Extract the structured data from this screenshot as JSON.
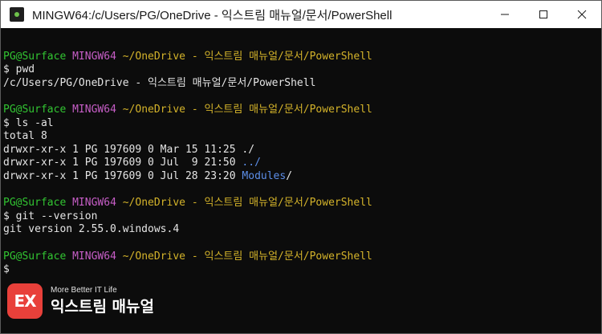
{
  "window": {
    "title": "MINGW64:/c/Users/PG/OneDrive - 익스트림 매뉴얼/문서/PowerShell"
  },
  "prompt": {
    "user_host": "PG@Surface",
    "shell": "MINGW64",
    "path": "~/OneDrive - 익스트림 매뉴얼/문서/PowerShell"
  },
  "terminal": {
    "cmd1": "$ pwd",
    "out1": "/c/Users/PG/OneDrive - 익스트림 매뉴얼/문서/PowerShell",
    "cmd2": "$ ls -al",
    "out2_total": "total 8",
    "out2_row1": "drwxr-xr-x 1 PG 197609 0 Mar 15 11:25 ./",
    "out2_row2_prefix": "drwxr-xr-x 1 PG 197609 0 Jul  9 21:50 ",
    "out2_row2_name": "../",
    "out2_row3_prefix": "drwxr-xr-x 1 PG 197609 0 Jul 28 23:20 ",
    "out2_row3_name": "Modules",
    "out2_row3_suffix": "/",
    "cmd3": "$ git --version",
    "out3": "git version 2.55.0.windows.4",
    "cursor_line": "$"
  },
  "watermark": {
    "mark": "EX",
    "tagline": "More Better IT Life",
    "name": "익스트림 매뉴얼"
  },
  "colors": {
    "prompt_user": "#32c532",
    "prompt_shell": "#c75ec7",
    "prompt_path": "#d4b32a",
    "directory": "#5c8ee8",
    "brand": "#e8403a"
  },
  "icons": {
    "app": "git-bash-icon",
    "minimize": "minimize-icon",
    "maximize": "maximize-icon",
    "close": "close-icon"
  }
}
